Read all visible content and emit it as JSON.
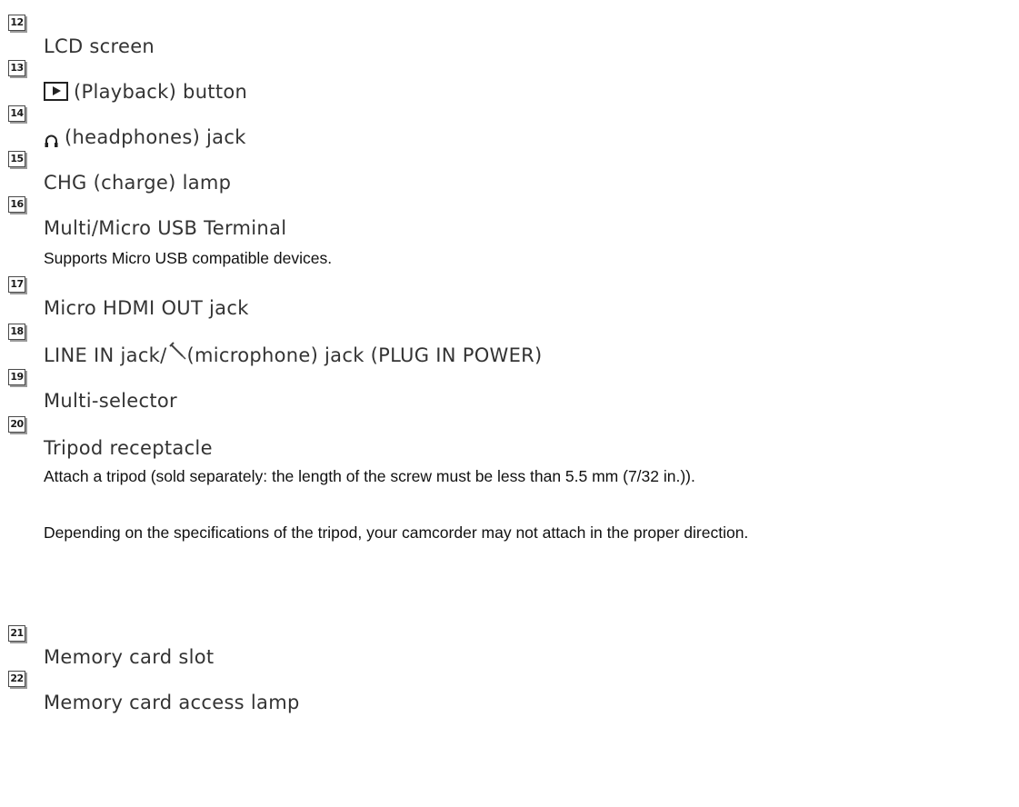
{
  "items": [
    {
      "num": "12",
      "title": "LCD screen"
    },
    {
      "num": "13",
      "icon": "playback-icon",
      "title": "(Playback) button"
    },
    {
      "num": "14",
      "icon": "headphones-icon",
      "title": "(headphones) jack"
    },
    {
      "num": "15",
      "title": "CHG (charge) lamp"
    },
    {
      "num": "16",
      "title": "Multi/Micro USB Terminal",
      "desc": [
        "Supports Micro USB compatible devices."
      ]
    },
    {
      "num": "17",
      "title": "Micro HDMI OUT jack"
    },
    {
      "num": "18",
      "icon": "microphone-icon",
      "title_before": "LINE IN jack/",
      "title_after": "(microphone) jack (PLUG IN POWER)"
    },
    {
      "num": "19",
      "title": "Multi-selector"
    },
    {
      "num": "20",
      "title": "Tripod receptacle",
      "desc": [
        "Attach a tripod (sold separately: the length of the screw must be less than 5.5 mm (7/32 in.)).",
        "Depending on the specifications of the tripod, your camcorder may not attach in the proper direction."
      ]
    },
    {
      "num": "21",
      "title": "Memory card slot"
    },
    {
      "num": "22",
      "title": "Memory card access lamp"
    }
  ]
}
